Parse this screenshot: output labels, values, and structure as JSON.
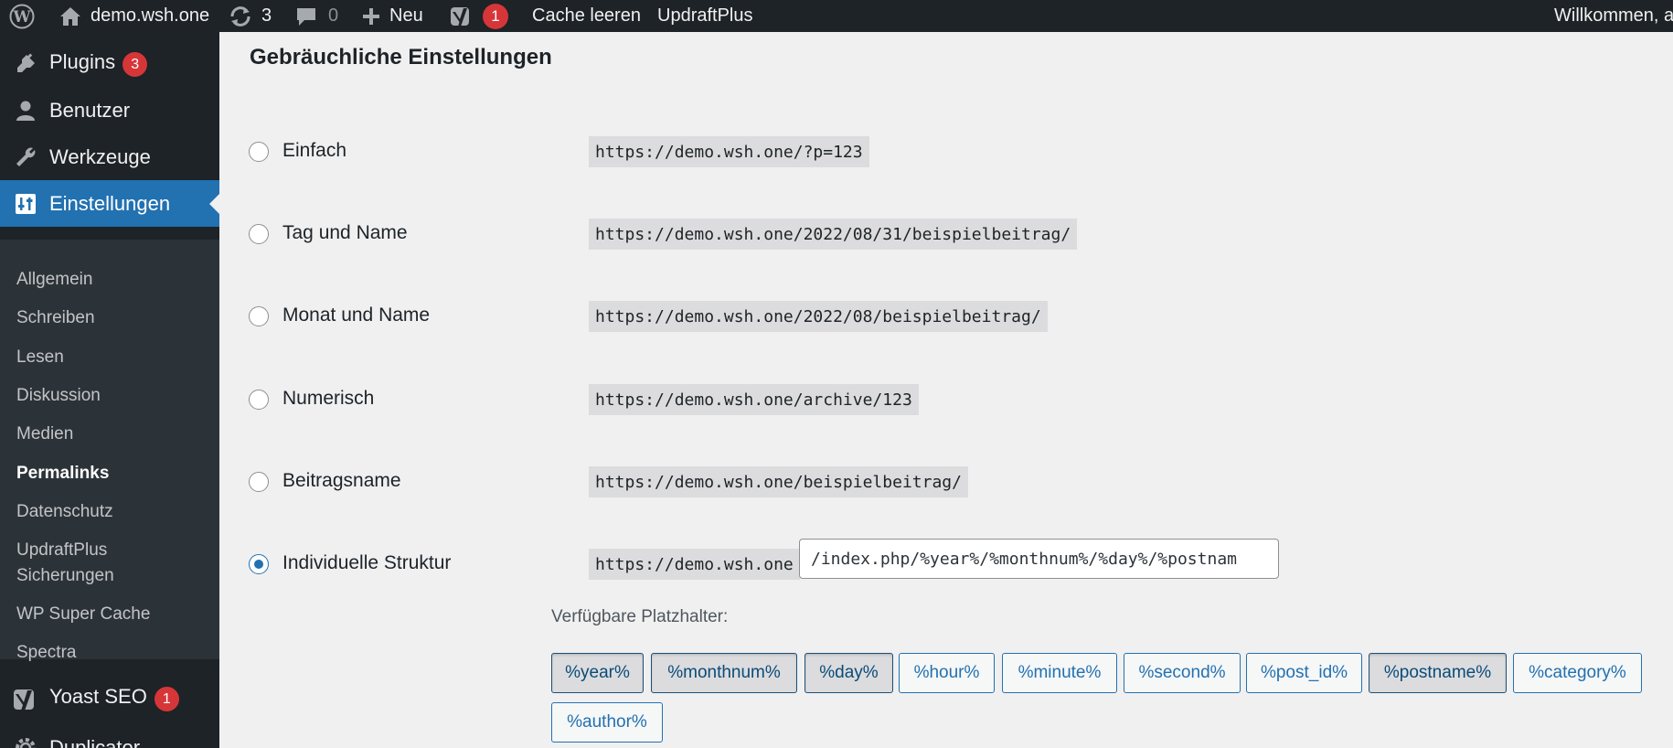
{
  "admin_bar": {
    "site_name": "demo.wsh.one",
    "updates_count": "3",
    "comments_count": "0",
    "new_label": "Neu",
    "yoast_count": "1",
    "cache_label": "Cache leeren",
    "updraft_label": "UpdraftPlus",
    "welcome": "Willkommen, a"
  },
  "sidebar": {
    "plugins": {
      "label": "Plugins",
      "badge": "3"
    },
    "users": {
      "label": "Benutzer"
    },
    "tools": {
      "label": "Werkzeuge"
    },
    "settings": {
      "label": "Einstellungen"
    },
    "submenu": [
      {
        "label": "Allgemein"
      },
      {
        "label": "Schreiben"
      },
      {
        "label": "Lesen"
      },
      {
        "label": "Diskussion"
      },
      {
        "label": "Medien"
      },
      {
        "label": "Permalinks"
      },
      {
        "label": "Datenschutz"
      },
      {
        "label": "UpdraftPlus"
      },
      {
        "label": "Sicherungen"
      },
      {
        "label": "WP Super Cache"
      },
      {
        "label": "Spectra"
      }
    ],
    "yoast": {
      "label": "Yoast SEO",
      "badge": "1"
    },
    "duplicator": {
      "label": "Duplicator"
    }
  },
  "main": {
    "title": "Gebräuchliche Einstellungen",
    "options": [
      {
        "label": "Einfach",
        "url": "https://demo.wsh.one/?p=123"
      },
      {
        "label": "Tag und Name",
        "url": "https://demo.wsh.one/2022/08/31/beispielbeitrag/"
      },
      {
        "label": "Monat und Name",
        "url": "https://demo.wsh.one/2022/08/beispielbeitrag/"
      },
      {
        "label": "Numerisch",
        "url": "https://demo.wsh.one/archive/123"
      },
      {
        "label": "Beitragsname",
        "url": "https://demo.wsh.one/beispielbeitrag/"
      },
      {
        "label": "Individuelle Struktur",
        "url": "https://demo.wsh.one"
      }
    ],
    "custom_structure_value": "/index.php/%year%/%monthnum%/%day%/%postnam",
    "available_label": "Verfügbare Platzhalter:",
    "tags": [
      "%year%",
      "%monthnum%",
      "%day%",
      "%hour%",
      "%minute%",
      "%second%",
      "%post_id%",
      "%postname%",
      "%category%",
      "%author%"
    ]
  }
}
